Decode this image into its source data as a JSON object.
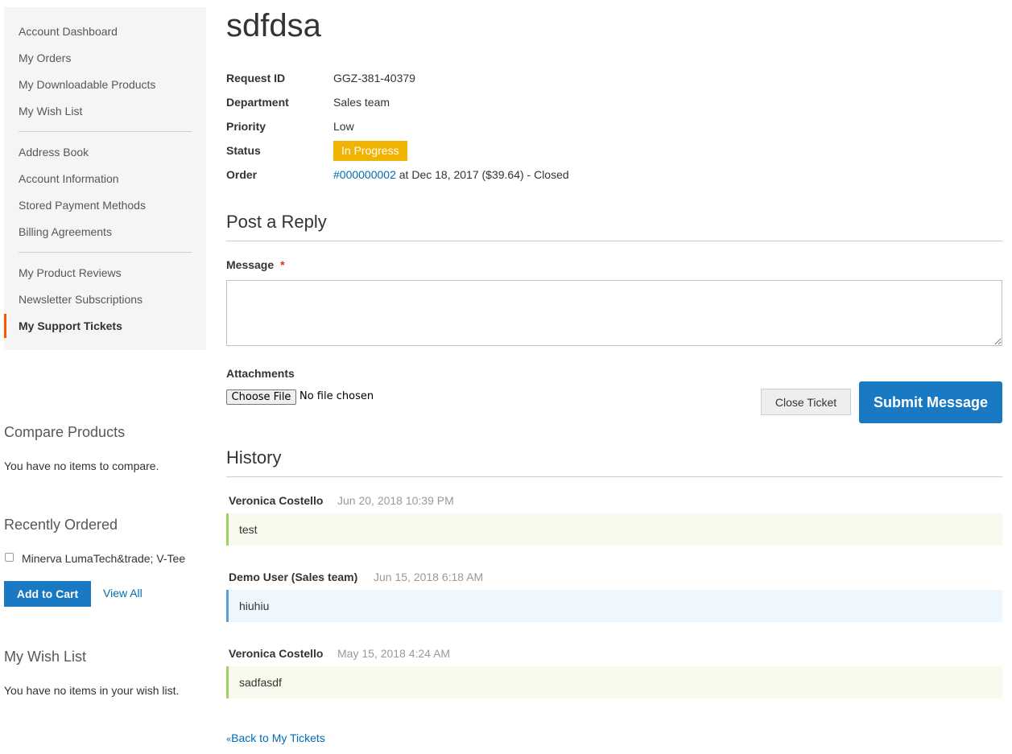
{
  "sidebar": {
    "nav_groups": [
      [
        "Account Dashboard",
        "My Orders",
        "My Downloadable Products",
        "My Wish List"
      ],
      [
        "Address Book",
        "Account Information",
        "Stored Payment Methods",
        "Billing Agreements"
      ],
      [
        "My Product Reviews",
        "Newsletter Subscriptions",
        "My Support Tickets"
      ]
    ],
    "current_item": "My Support Tickets",
    "compare": {
      "title": "Compare Products",
      "empty_text": "You have no items to compare."
    },
    "recently_ordered": {
      "title": "Recently Ordered",
      "product": "Minerva LumaTech&trade; V-Tee",
      "product_checked": false,
      "add_to_cart_label": "Add to Cart",
      "view_all_label": "View All"
    },
    "wishlist": {
      "title": "My Wish List",
      "empty_text": "You have no items in your wish list."
    }
  },
  "ticket": {
    "title": "sdfdsa",
    "fields": {
      "request_id": {
        "label": "Request ID",
        "value": "GGZ-381-40379"
      },
      "department": {
        "label": "Department",
        "value": "Sales team"
      },
      "priority": {
        "label": "Priority",
        "value": "Low"
      },
      "status": {
        "label": "Status",
        "value": "In Progress"
      },
      "order": {
        "label": "Order",
        "number": "#000000002",
        "rest": " at Dec 18, 2017 ($39.64) - Closed"
      }
    }
  },
  "reply": {
    "title": "Post a Reply",
    "message_label": "Message",
    "required_mark": "*",
    "message_value": "",
    "attachments_label": "Attachments",
    "choose_file_label": "Choose File",
    "no_file_text": "No file chosen",
    "close_ticket_label": "Close Ticket",
    "submit_label": "Submit Message"
  },
  "history": {
    "title": "History",
    "entries": [
      {
        "author": "Veronica Costello",
        "date": "Jun 20, 2018 10:39 PM",
        "body": "test",
        "type": "customer"
      },
      {
        "author": "Demo User (Sales team)",
        "date": "Jun 15, 2018 6:18 AM",
        "body": "hiuhiu",
        "type": "staff"
      },
      {
        "author": "Veronica Costello",
        "date": "May 15, 2018 4:24 AM",
        "body": "sadfasdf",
        "type": "customer"
      }
    ]
  },
  "back_link": {
    "prefix": "«",
    "label": "Back to My Tickets"
  },
  "colors": {
    "accent_blue": "#1979c3",
    "link_blue": "#006bb4",
    "status_badge": "#f1b301",
    "current_nav_marker": "#ff5501",
    "customer_message_border": "#a3cf6a",
    "staff_message_border": "#5a9fd6"
  }
}
